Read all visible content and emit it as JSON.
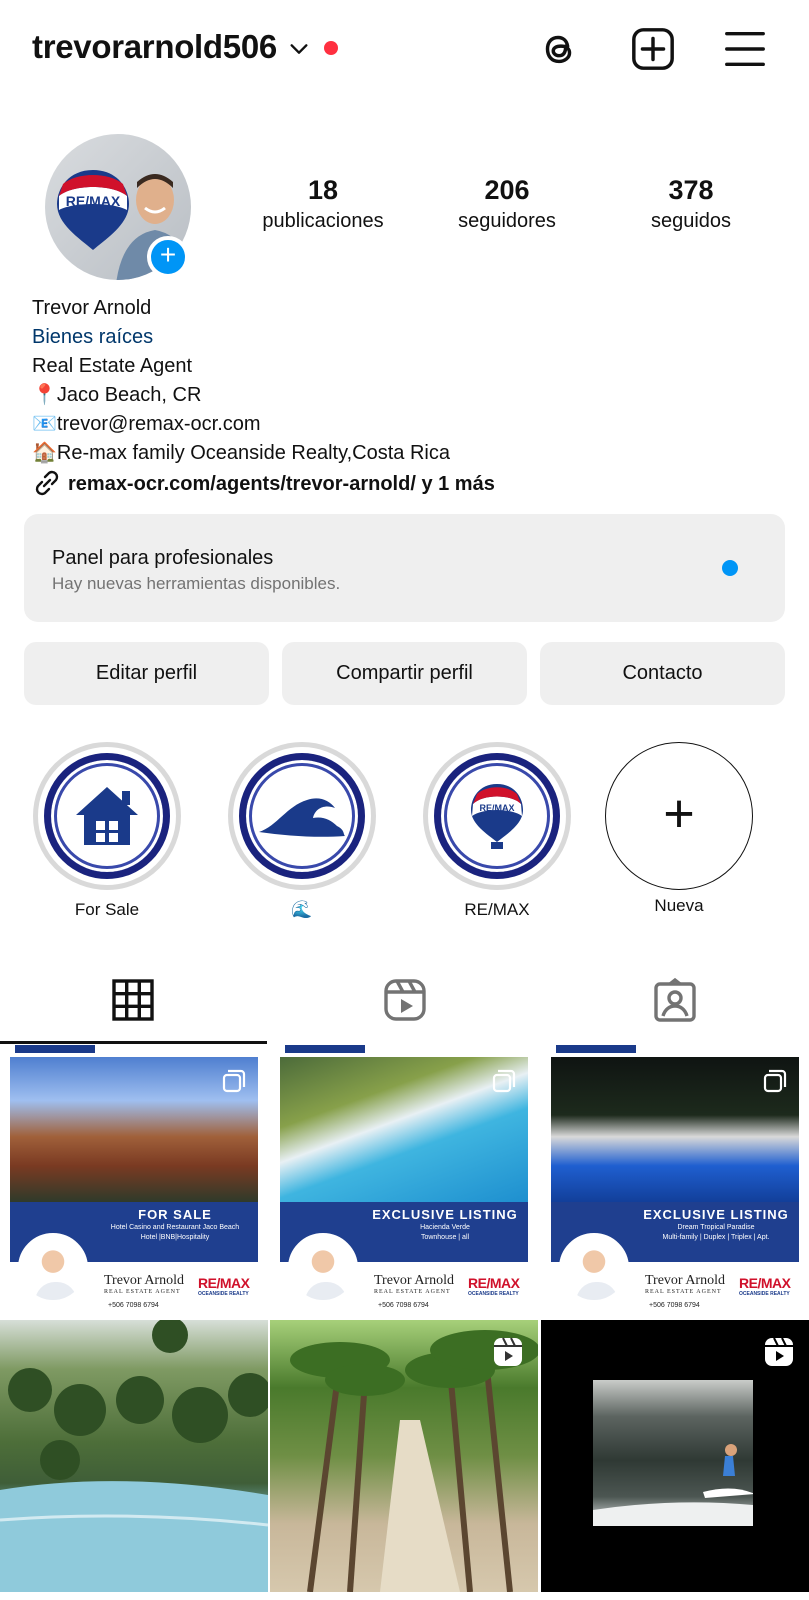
{
  "header": {
    "username": "trevorarnold506",
    "icons": [
      "chevron-down-icon",
      "threads-icon",
      "create-post-icon",
      "menu-icon"
    ],
    "notification_color": "#ff3040"
  },
  "profile": {
    "avatar_text": "RE/MAX",
    "stats": [
      {
        "value": "18",
        "label": "publicaciones"
      },
      {
        "value": "206",
        "label": "seguidores"
      },
      {
        "value": "378",
        "label": "seguidos"
      }
    ],
    "name": "Trevor Arnold",
    "category": "Bienes raíces",
    "bio_lines": [
      "Real Estate Agent",
      "📍Jaco Beach, CR",
      "📧trevor@remax-ocr.com",
      "🏠Re-max family Oceanside Realty,Costa Rica"
    ],
    "link": "remax-ocr.com/agents/trevor-arnold/ y 1 más"
  },
  "panel": {
    "title": "Panel para profesionales",
    "subtitle": "Hay nuevas herramientas disponibles.",
    "dot_color": "#0095f6"
  },
  "buttons": {
    "edit": "Editar perfil",
    "share": "Compartir perfil",
    "contact": "Contacto"
  },
  "highlights": [
    {
      "label": "For Sale",
      "icon": "house-icon"
    },
    {
      "label": "🌊",
      "icon": "wave-icon"
    },
    {
      "label": "RE/MAX",
      "icon": "balloon-icon"
    },
    {
      "label": "Nueva",
      "icon": "plus-icon"
    }
  ],
  "tabs": [
    "grid-icon",
    "reels-icon",
    "tagged-icon"
  ],
  "posts": [
    {
      "type": "listing",
      "title": "FOR SALE",
      "subtitle": "Hotel Casino and Restaurant Jaco Beach",
      "detail": "Hotel |BNB|Hospitality",
      "agent": "Trevor Arnold",
      "agent_role": "REAL ESTATE AGENT",
      "phone": "+506 7098 6794",
      "logo": "RE/MAX"
    },
    {
      "type": "listing",
      "title": "EXCLUSIVE LISTING",
      "subtitle": "Hacienda Verde",
      "detail": "Townhouse | all",
      "agent": "Trevor Arnold",
      "agent_role": "REAL ESTATE AGENT",
      "phone": "+506 7098 6794",
      "logo": "RE/MAX"
    },
    {
      "type": "listing",
      "title": "EXCLUSIVE LISTING",
      "subtitle": "Dream Tropical Paradise",
      "detail": "Multi-family | Duplex | Triplex | Apt.",
      "agent": "Trevor Arnold",
      "agent_role": "REAL ESTATE AGENT",
      "phone": "+506 7098 6794",
      "logo": "RE/MAX"
    },
    {
      "type": "photo",
      "scene": "golf course"
    },
    {
      "type": "reel",
      "scene": "palm road"
    },
    {
      "type": "reel",
      "scene": "surf wave"
    }
  ]
}
